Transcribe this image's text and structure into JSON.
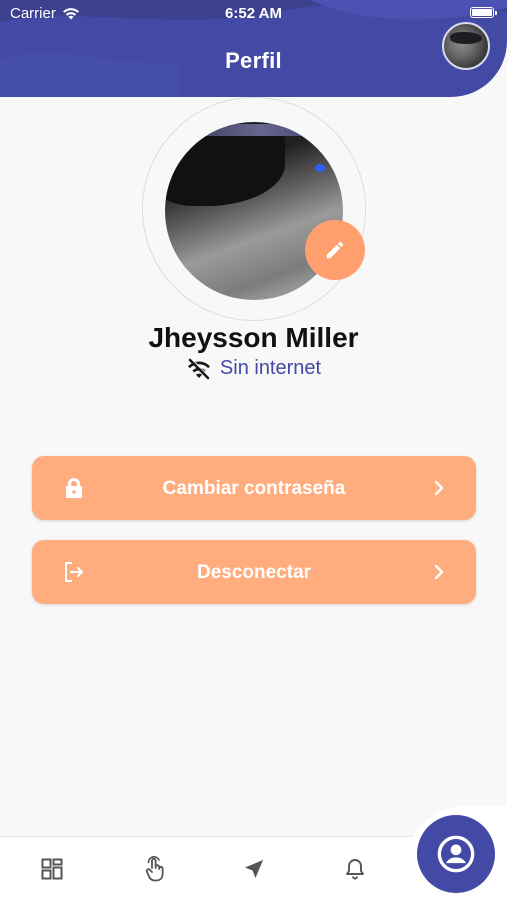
{
  "status_bar": {
    "carrier": "Carrier",
    "time": "6:52 AM"
  },
  "header": {
    "title": "Perfil"
  },
  "profile": {
    "name": "Jheysson Miller",
    "connection_status": "Sin internet"
  },
  "actions": [
    {
      "label": "Cambiar contraseña",
      "icon": "lock-icon"
    },
    {
      "label": "Desconectar",
      "icon": "logout-icon"
    }
  ],
  "nav": {
    "items": [
      "dashboard-icon",
      "touch-icon",
      "navigation-icon",
      "bell-icon",
      "account-icon"
    ],
    "active": "account-icon"
  },
  "colors": {
    "primary": "#434aa6",
    "accent": "#ff9f6e",
    "button": "#ffac7e",
    "background": "#f8f8f8"
  }
}
